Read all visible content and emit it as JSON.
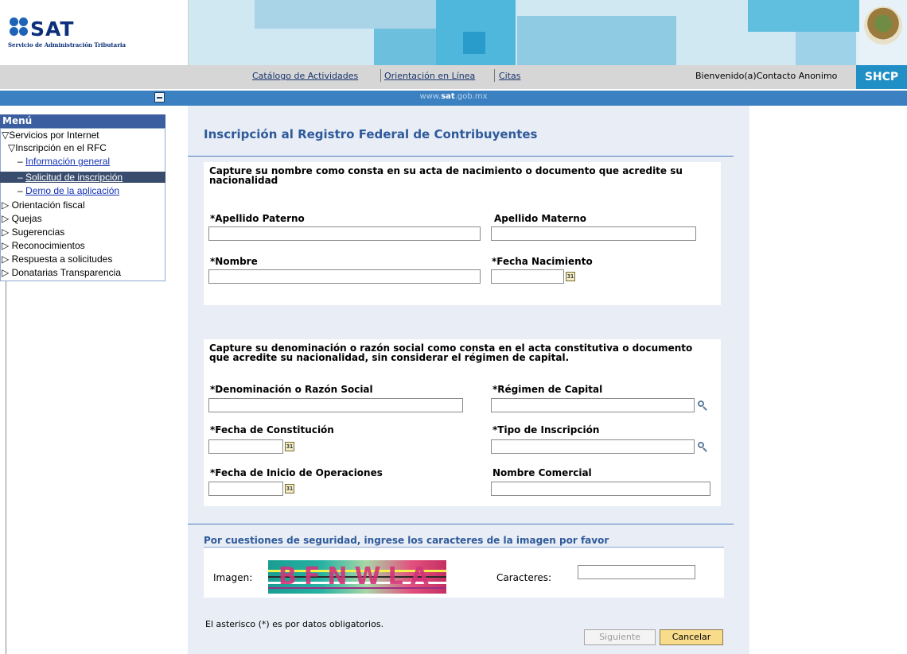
{
  "header": {
    "logo_text": "SAT",
    "logo_subtitle": "Servicio de Administración Tributaria",
    "nav_links": [
      "Catálogo de Actividades",
      "Orientación en Línea",
      "Citas"
    ],
    "welcome": "Bienvenido(a)Contacto Anonimo",
    "shcp": "SHCP",
    "site_prefix": "www.",
    "site_bold": "sat",
    "site_suffix": ".gob.mx"
  },
  "menu": {
    "title": "Menú",
    "items": [
      {
        "label": "Servicios por Internet",
        "marker": "▽"
      },
      {
        "label": "Inscripción en el RFC",
        "marker": "▽"
      },
      {
        "label": "Información general",
        "marker": "–"
      },
      {
        "label": "Solicitud de inscripción",
        "marker": "–"
      },
      {
        "label": "Demo de la aplicación",
        "marker": "–"
      },
      {
        "label": "Orientación fiscal",
        "marker": "▷"
      },
      {
        "label": "Quejas",
        "marker": "▷"
      },
      {
        "label": "Sugerencias",
        "marker": "▷"
      },
      {
        "label": "Reconocimientos",
        "marker": "▷"
      },
      {
        "label": "Respuesta a solicitudes",
        "marker": "▷"
      },
      {
        "label": "Donatarias Transparencia",
        "marker": "▷"
      }
    ]
  },
  "main": {
    "title": "Inscripción al Registro Federal de Contribuyentes",
    "section1": {
      "instruction": "Capture su nombre como consta en su acta de nacimiento o documento que acredite su nacionalidad",
      "apellido_paterno": "*Apellido Paterno",
      "apellido_materno": "Apellido Materno",
      "nombre": "*Nombre",
      "fecha_nacimiento": "*Fecha Nacimiento"
    },
    "section2": {
      "instruction": "Capture su denominación o razón social como consta en el acta constitutiva o documento que acredite su nacionalidad, sin considerar el régimen de capital.",
      "denominacion": "*Denominación o Razón Social",
      "regimen": "*Régimen de Capital",
      "fecha_constitucion": "*Fecha de Constitución",
      "tipo_inscripcion": "*Tipo de Inscripción",
      "fecha_inicio": "*Fecha de Inicio de Operaciones",
      "nombre_comercial": "Nombre Comercial"
    },
    "security": {
      "title": "Por cuestiones de seguridad, ingrese los caracteres de la imagen por favor",
      "imagen_label": "Imagen:",
      "captcha_text": "BFNWLA",
      "caracteres_label": "Caracteres:"
    },
    "footnote": "El asterisco (*) es por datos obligatorios.",
    "buttons": {
      "siguiente": "Siguiente",
      "cancelar": "Cancelar"
    }
  },
  "colors": {
    "accent": "#2e5a9a",
    "menu_header": "#3a5ea0",
    "shcp": "#1f8fc6",
    "page_bg": "#e8edf6"
  }
}
